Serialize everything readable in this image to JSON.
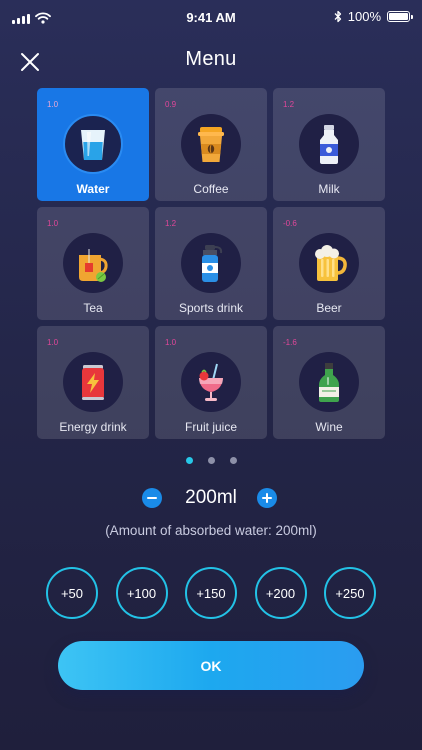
{
  "status_bar": {
    "time": "9:41 AM",
    "battery": "100%"
  },
  "header": {
    "title": "Menu"
  },
  "drinks": [
    {
      "name": "Water",
      "factor": "1.0",
      "icon": "water-glass-icon",
      "selected": true
    },
    {
      "name": "Coffee",
      "factor": "0.9",
      "icon": "coffee-cup-icon"
    },
    {
      "name": "Milk",
      "factor": "1.2",
      "icon": "milk-bottle-icon"
    },
    {
      "name": "Tea",
      "factor": "1.0",
      "icon": "tea-cup-icon"
    },
    {
      "name": "Sports drink",
      "factor": "1.2",
      "icon": "sports-bottle-icon"
    },
    {
      "name": "Beer",
      "factor": "-0.6",
      "icon": "beer-mug-icon"
    },
    {
      "name": "Energy drink",
      "factor": "1.0",
      "icon": "energy-can-icon"
    },
    {
      "name": "Fruit juice",
      "factor": "1.0",
      "icon": "fruit-juice-icon"
    },
    {
      "name": "Wine",
      "factor": "-1.6",
      "icon": "wine-bottle-icon"
    }
  ],
  "pager": {
    "count": 3,
    "active_index": 0
  },
  "amount": {
    "value": "200ml",
    "absorbed": "(Amount of absorbed water: 200ml)"
  },
  "quick_add": [
    "+50",
    "+100",
    "+150",
    "+200",
    "+250"
  ],
  "ok_label": "OK",
  "colors": {
    "accent": "#1877e6",
    "ring": "#23c2e6",
    "factor": "#e0479a",
    "background": "#252748"
  }
}
